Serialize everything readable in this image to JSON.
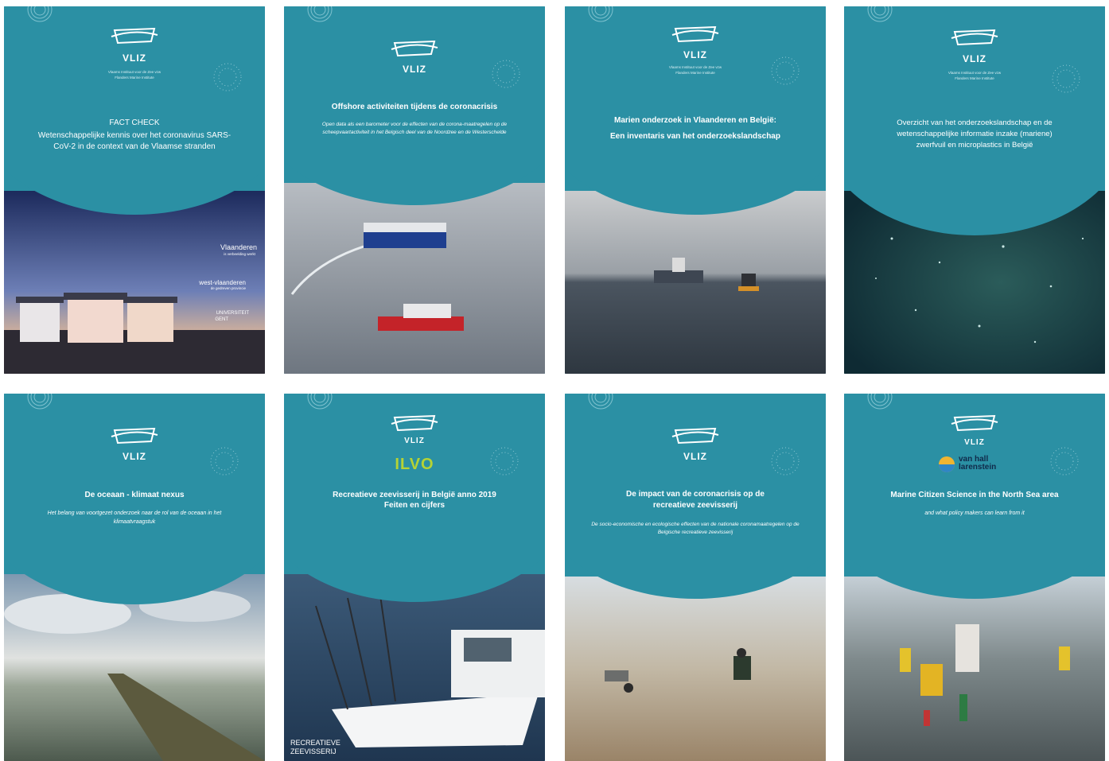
{
  "publisher": {
    "logo_word": "VLIZ",
    "tagline_1": "Vlaams Instituut voor de Zee vzw",
    "tagline_2": "Flanders Marine Institute"
  },
  "covers": [
    {
      "kicker": "FACT CHECK",
      "title": "Wetenschappelijke kennis over het coronavirus SARS-CoV-2 in de context van de Vlaamse stranden",
      "partners": [
        "Vlaanderen",
        "is verbeelding werkt",
        "west-vlaanderen",
        "de gedreven provincie",
        "UNIVERSITEIT",
        "GENT"
      ]
    },
    {
      "title": "Offshore activiteiten tijdens de coronacrisis",
      "subtitle": "Open data als een barometer voor de effecten van de corona-maatregelen op de scheepvaartactiviteit in het Belgisch deel van de Noordzee en de Westerschelde"
    },
    {
      "title": "Marien onderzoek in Vlaanderen en België:",
      "title_2": "Een inventaris van het onderzoekslandschap"
    },
    {
      "title": "Overzicht van het onderzoekslandschap en de wetenschappelijke informatie inzake (mariene) zwerfvuil en microplastics in België"
    },
    {
      "title": "De oceaan - klimaat nexus",
      "subtitle": "Het belang van voortgezet onderzoek naar de rol van de oceaan in het klimaatvraagstuk"
    },
    {
      "co_logo": "ILVO",
      "title": "Recreatieve zeevisserij in België anno 2019",
      "title_2": "Feiten en cijfers",
      "partners": [
        "RECREATIEVE",
        "ZEEVISSERIJ"
      ]
    },
    {
      "title": "De impact van de coronacrisis op de recreatieve zeevisserij",
      "subtitle": "De socio-economische en ecologische effecten van de nationale coronamaatregelen op de Belgische recreatieve zeevisserij"
    },
    {
      "co_logo": "van hall larenstein",
      "title": "Marine Citizen Science in the North Sea area",
      "subtitle": "and what policy makers can learn from it"
    }
  ]
}
